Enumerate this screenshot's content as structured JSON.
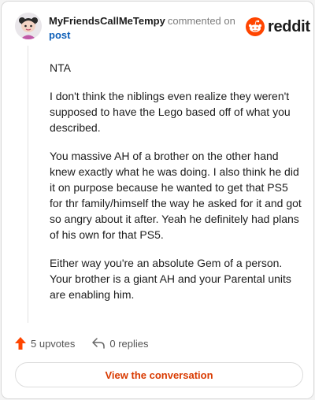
{
  "header": {
    "username": "MyFriendsCallMeTempy",
    "action_text": "commented on",
    "post_link": "post"
  },
  "brand": {
    "name": "reddit",
    "color": "#ff4500"
  },
  "comment": {
    "paragraphs": [
      "NTA",
      "I don't think the niblings even realize they weren't supposed to have the Lego based off of what you described.",
      "You massive AH of a brother on the other hand knew exactly what he was doing. I also think he did it on purpose because he wanted to get that PS5 for thr family/himself the way he asked for it and got so angry about it after. Yeah he definitely had plans of his own for that PS5.",
      "Either way you're an absolute Gem of a person. Your brother is a giant AH and your Parental units are enabling him."
    ]
  },
  "actions": {
    "upvotes_label": "5 upvotes",
    "replies_label": "0 replies"
  },
  "footer": {
    "view_button_label": "View the conversation"
  },
  "colors": {
    "accent": "#d93a00",
    "upvote": "#ff4500",
    "link": "#0d5fb8"
  }
}
